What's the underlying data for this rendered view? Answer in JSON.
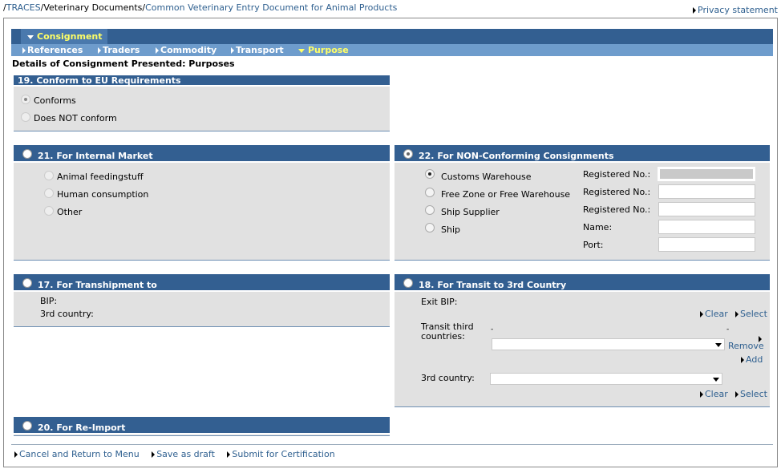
{
  "breadcrumb": {
    "root": "TRACES",
    "section": "Veterinary Documents",
    "current": "Common Veterinary Entry Document for Animal Products"
  },
  "privacy_link": "Privacy statement",
  "tabs": {
    "main": "Consignment",
    "sub": [
      "References",
      "Traders",
      "Commodity",
      "Transport",
      "Purpose"
    ],
    "active_sub": "Purpose"
  },
  "page_heading": "Details of Consignment Presented: Purposes",
  "box19": {
    "title": "19. Conform to EU Requirements",
    "options": [
      "Conforms",
      "Does NOT conform"
    ],
    "selected": "Conforms"
  },
  "box21": {
    "title": "21. For Internal Market",
    "options": [
      "Animal feedingstuff",
      "Human consumption",
      "Other"
    ]
  },
  "box22": {
    "title": "22. For NON-Conforming Consignments",
    "options": [
      "Customs Warehouse",
      "Free Zone or Free Warehouse",
      "Ship Supplier",
      "Ship"
    ],
    "selected": "Customs Warehouse",
    "field_labels": [
      "Registered No.:",
      "Registered No.:",
      "Registered No.:",
      "Name:",
      "Port:"
    ]
  },
  "box17": {
    "title": "17. For Transhipment to",
    "bip_label": "BIP:",
    "country_label": "3rd country:"
  },
  "box18": {
    "title": "18. For Transit to 3rd Country",
    "exit_bip_label": "Exit BIP:",
    "transit_label_1": "Transit third",
    "transit_label_2": "countries:",
    "country_label": "3rd country:",
    "clear_label": "Clear",
    "select_label": "Select",
    "remove_label": "Remove",
    "add_label": "Add",
    "dash": "-"
  },
  "box20": {
    "title": "20. For Re-Import"
  },
  "actions": [
    "Cancel and Return to Menu",
    "Save as draft",
    "Submit for Certification"
  ],
  "colors": {
    "header_blue": "#335f91",
    "subtab_blue": "#6e9ccc",
    "active_tab_text": "#ffff66",
    "panel_bg": "#e1e1e1",
    "link": "#2e5f8f"
  }
}
